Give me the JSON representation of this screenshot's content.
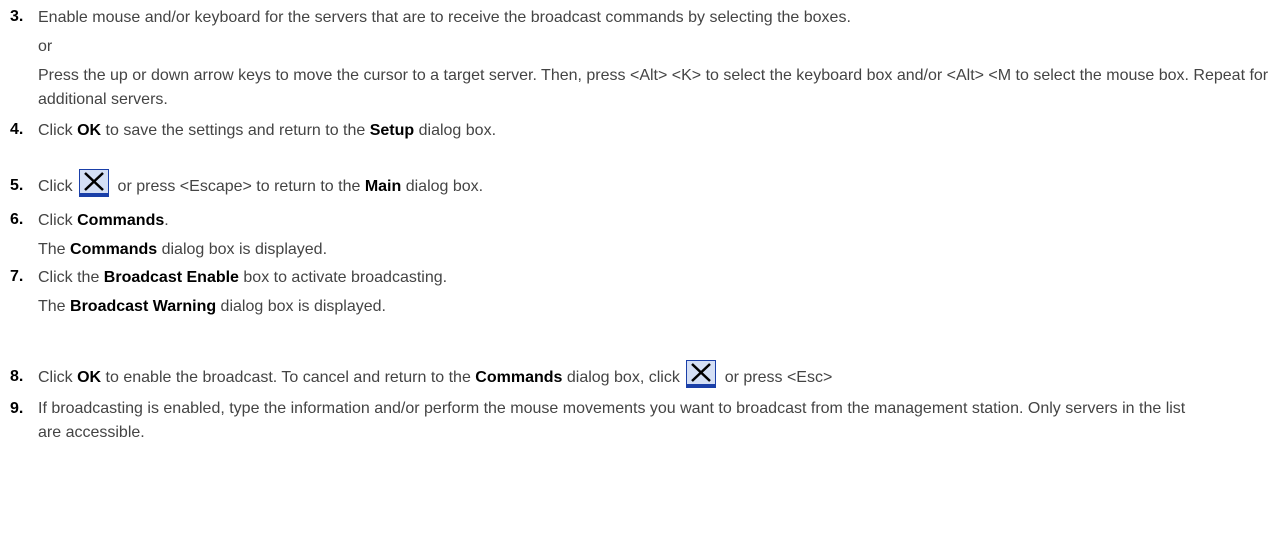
{
  "steps": [
    {
      "num": "3.",
      "text": "Enable mouse and/or keyboard for the servers that are to receive the broadcast commands by selecting the boxes.",
      "or": "or",
      "alt": "Press the up or down arrow keys to move the cursor to a target server. Then, press <Alt> <K> to select the keyboard box and/or <Alt> <M to select the mouse box. Repeat for additional servers."
    },
    {
      "num": "4.",
      "pre": "Click ",
      "b1": "OK",
      "mid": " to save the settings and return to the ",
      "b2": "Setup",
      "post": " dialog box."
    },
    {
      "num": "5.",
      "pre": "Click ",
      "mid": " or press <Escape> to return to the ",
      "b1": "Main",
      "post": " dialog box."
    },
    {
      "num": "6.",
      "pre": "Click ",
      "b1": "Commands",
      "post": ".",
      "res_pre": "The ",
      "res_b": "Commands",
      "res_post": " dialog box is displayed."
    },
    {
      "num": "7.",
      "pre": "Click the ",
      "b1": "Broadcast Enable",
      "post": " box to activate broadcasting.",
      "res_pre": "The ",
      "res_b": "Broadcast Warning",
      "res_post": " dialog box is displayed."
    },
    {
      "num": "8.",
      "pre": "Click ",
      "b1": "OK",
      "mid": " to enable the broadcast. To cancel and return to the ",
      "b2": "Commands",
      "mid2": " dialog box, click ",
      "post": " or press <Esc>"
    },
    {
      "num": "9.",
      "text": "If broadcasting is enabled, type the information and/or perform the mouse movements you want to broadcast from the management station. Only servers in the list are accessible."
    }
  ],
  "icons": {
    "close": "close-x-icon",
    "color": "#1a3fa8"
  }
}
